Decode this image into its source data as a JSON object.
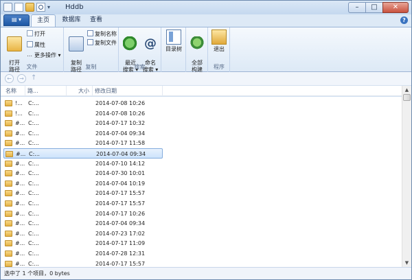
{
  "window": {
    "title": "Hddb"
  },
  "qat": {
    "dropdown": "▾"
  },
  "window_buttons": {
    "minimize": "–",
    "maximize": "□",
    "close": "✕"
  },
  "ribbon_tabs": {
    "file": "▤ ▾",
    "home": "主页",
    "database": "数据库",
    "view": "查看",
    "help": "?"
  },
  "ribbon": {
    "groups": {
      "file": "文件",
      "copy": "复制",
      "search": "搜索",
      "program": "程序"
    },
    "open_path": "打开\n路径",
    "open": "打开",
    "properties": "属性",
    "more_actions": "更多操作 ▾",
    "copy_path": "复制\n路径",
    "copy_name": "复制名称",
    "copy_file": "复制文件",
    "recent_search": "最近\n搜索 ▾",
    "name_search": "命名\n搜索 ▾",
    "dir_tree": "目录树",
    "rebuild_all": "全部\n构建",
    "exit": "退出"
  },
  "nav": {
    "back": "←",
    "forward": "→",
    "up": "↑"
  },
  "columns": {
    "name": "名称",
    "path": "路...",
    "size": "大小",
    "modified": "修改日期"
  },
  "rows": [
    {
      "name": "!...",
      "path": "C:...",
      "date": "2014-07-08 10:26"
    },
    {
      "name": "!...",
      "path": "C:...",
      "date": "2014-07-08 10:26"
    },
    {
      "name": "#...",
      "path": "C:...",
      "date": "2014-07-17 10:32"
    },
    {
      "name": "#...",
      "path": "C:...",
      "date": "2014-07-04 09:34"
    },
    {
      "name": "#...",
      "path": "C:...",
      "date": "2014-07-17 11:58"
    },
    {
      "name": "#...",
      "path": "C:...",
      "date": "2014-07-04 09:34"
    },
    {
      "name": "#...",
      "path": "C:...",
      "date": "2014-07-10 14:12"
    },
    {
      "name": "#...",
      "path": "C:...",
      "date": "2014-07-30 10:01"
    },
    {
      "name": "#...",
      "path": "C:...",
      "date": "2014-07-04 10:19"
    },
    {
      "name": "#...",
      "path": "C:...",
      "date": "2014-07-17 15:57"
    },
    {
      "name": "#...",
      "path": "C:...",
      "date": "2014-07-17 15:57"
    },
    {
      "name": "#...",
      "path": "C:...",
      "date": "2014-07-17 10:26"
    },
    {
      "name": "#...",
      "path": "C:...",
      "date": "2014-07-04 09:34"
    },
    {
      "name": "#...",
      "path": "C:...",
      "date": "2014-07-23 17:02"
    },
    {
      "name": "#...",
      "path": "C:...",
      "date": "2014-07-17 11:09"
    },
    {
      "name": "#...",
      "path": "C:...",
      "date": "2014-07-28 12:31"
    },
    {
      "name": "#...",
      "path": "C:...",
      "date": "2014-07-17 15:57"
    }
  ],
  "selected_row": 5,
  "scroll": {
    "up": "▲",
    "down": "▼"
  },
  "status": {
    "text": "选中了 1 个项目，0 bytes"
  }
}
